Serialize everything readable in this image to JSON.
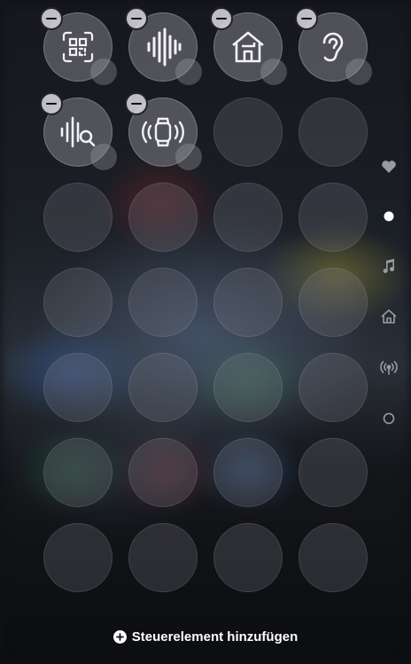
{
  "controls": [
    {
      "name": "code-scanner",
      "icon": "qr-code-scanner-icon"
    },
    {
      "name": "voice-memo",
      "icon": "waveform-icon"
    },
    {
      "name": "home",
      "icon": "home-icon"
    },
    {
      "name": "hearing",
      "icon": "ear-icon"
    },
    {
      "name": "recognize-music",
      "icon": "waveform-search-icon"
    },
    {
      "name": "ping-watch",
      "icon": "watch-ping-icon"
    }
  ],
  "page_rail": [
    "heart-icon",
    "current-page-dot",
    "music-note-icon",
    "home-outline-icon",
    "broadcast-icon",
    "empty-page-circle"
  ],
  "add_control": {
    "label": "Steuerelement hinzufügen",
    "icon": "plus-circle-icon"
  },
  "colors": {
    "text": "#ffffff",
    "badge": "#cdcdd2",
    "rail": "#9a9aa2"
  }
}
